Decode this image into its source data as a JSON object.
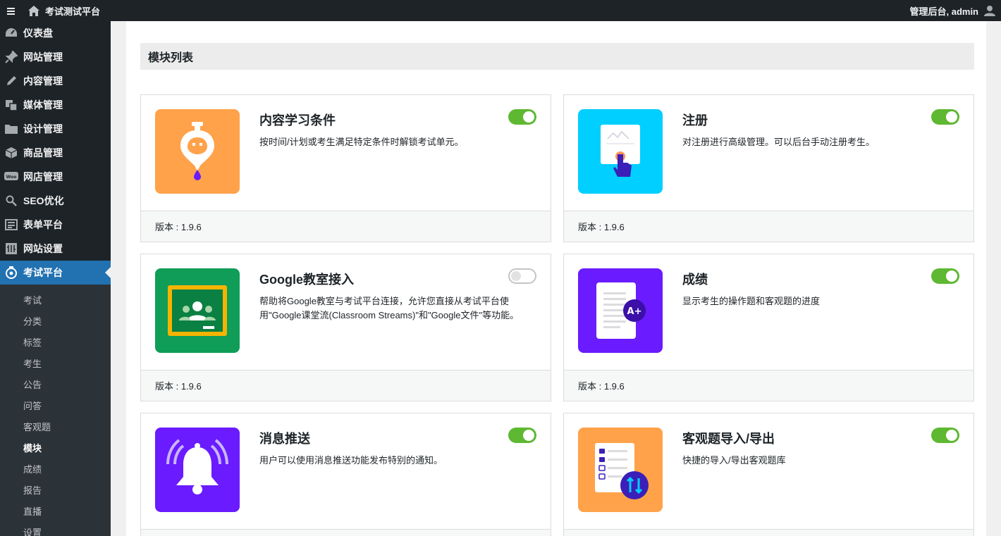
{
  "adminbar": {
    "site_title": "考试测试平台",
    "user_greeting": "管理后台, admin"
  },
  "sidebar": {
    "items": [
      {
        "label": "仪表盘",
        "icon": "dashboard-icon"
      },
      {
        "label": "网站管理",
        "icon": "pin-icon"
      },
      {
        "label": "内容管理",
        "icon": "edit-icon"
      },
      {
        "label": "媒体管理",
        "icon": "media-icon"
      },
      {
        "label": "设计管理",
        "icon": "folder-icon"
      },
      {
        "label": "商品管理",
        "icon": "box-icon"
      },
      {
        "label": "网店管理",
        "icon": "woo-icon"
      },
      {
        "label": "SEO优化",
        "icon": "search-icon"
      },
      {
        "label": "表单平台",
        "icon": "form-icon"
      },
      {
        "label": "网站设置",
        "icon": "settings-icon"
      },
      {
        "label": "考试平台",
        "icon": "exam-icon"
      }
    ],
    "submenu": [
      "考试",
      "分类",
      "标签",
      "考生",
      "公告",
      "问答",
      "客观题",
      "模块",
      "成绩",
      "报告",
      "直播",
      "设置"
    ],
    "current_submenu": "模块"
  },
  "main": {
    "section_title": "模块列表",
    "modules": [
      {
        "title": "内容学习条件",
        "desc": "按时间/计划或考生满足特定条件时解锁考试单元。",
        "version": "版本 : 1.9.6",
        "enabled": true,
        "thumb_color": "#ffa24a",
        "icon": "drip-lock-icon"
      },
      {
        "title": "注册",
        "desc": "对注册进行高级管理。可以后台手动注册考生。",
        "version": "版本 : 1.9.6",
        "enabled": true,
        "thumb_color": "#00cfff",
        "icon": "register-icon"
      },
      {
        "title": "Google教室接入",
        "desc": "帮助将Google教室与考试平台连接，允许您直接从考试平台使用\"Google课堂流(Classroom Streams)\"和\"Google文件\"等功能。",
        "version": "版本 : 1.9.6",
        "enabled": false,
        "thumb_color": "#0f9d58",
        "icon": "google-classroom-icon"
      },
      {
        "title": "成绩",
        "desc": "显示考生的操作题和客观题的进度",
        "version": "版本 : 1.9.6",
        "enabled": true,
        "thumb_color": "#6a1bff",
        "icon": "grade-icon"
      },
      {
        "title": "消息推送",
        "desc": "用户可以使用消息推送功能发布特别的通知。",
        "version": "",
        "enabled": true,
        "thumb_color": "#6a1bff",
        "icon": "bell-icon"
      },
      {
        "title": "客观题导入/导出",
        "desc": "快捷的导入/导出客观题库",
        "version": "",
        "enabled": true,
        "thumb_color": "#ffa24a",
        "icon": "import-export-icon"
      }
    ]
  },
  "colors": {
    "admin_dark": "#1d2327",
    "active_blue": "#2271b1",
    "toggle_on": "#5fb832"
  }
}
